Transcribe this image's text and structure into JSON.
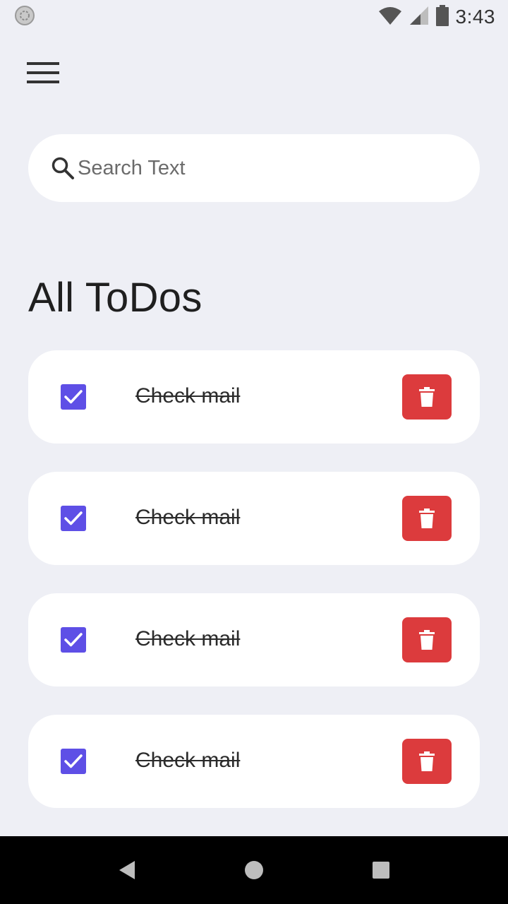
{
  "status_bar": {
    "time": "3:43",
    "icons": [
      "sync-icon",
      "wifi-icon",
      "signal-icon",
      "battery-icon"
    ]
  },
  "header": {
    "menu_icon": "hamburger-menu-icon"
  },
  "search": {
    "placeholder": "Search Text",
    "value": "",
    "icon": "search-icon"
  },
  "page": {
    "title": "All ToDos"
  },
  "todos": [
    {
      "text": "Check mail",
      "done": true
    },
    {
      "text": "Check mail",
      "done": true
    },
    {
      "text": "Check mail",
      "done": true
    },
    {
      "text": "Check mail",
      "done": true
    }
  ],
  "nav_bar": {
    "icons": [
      "back-icon",
      "home-icon",
      "recents-icon"
    ]
  },
  "colors": {
    "background": "#EEEFF5",
    "card": "#FFFFFF",
    "checkbox": "#5E4FE6",
    "delete": "#DC3B3D",
    "nav_bar": "#000000"
  }
}
